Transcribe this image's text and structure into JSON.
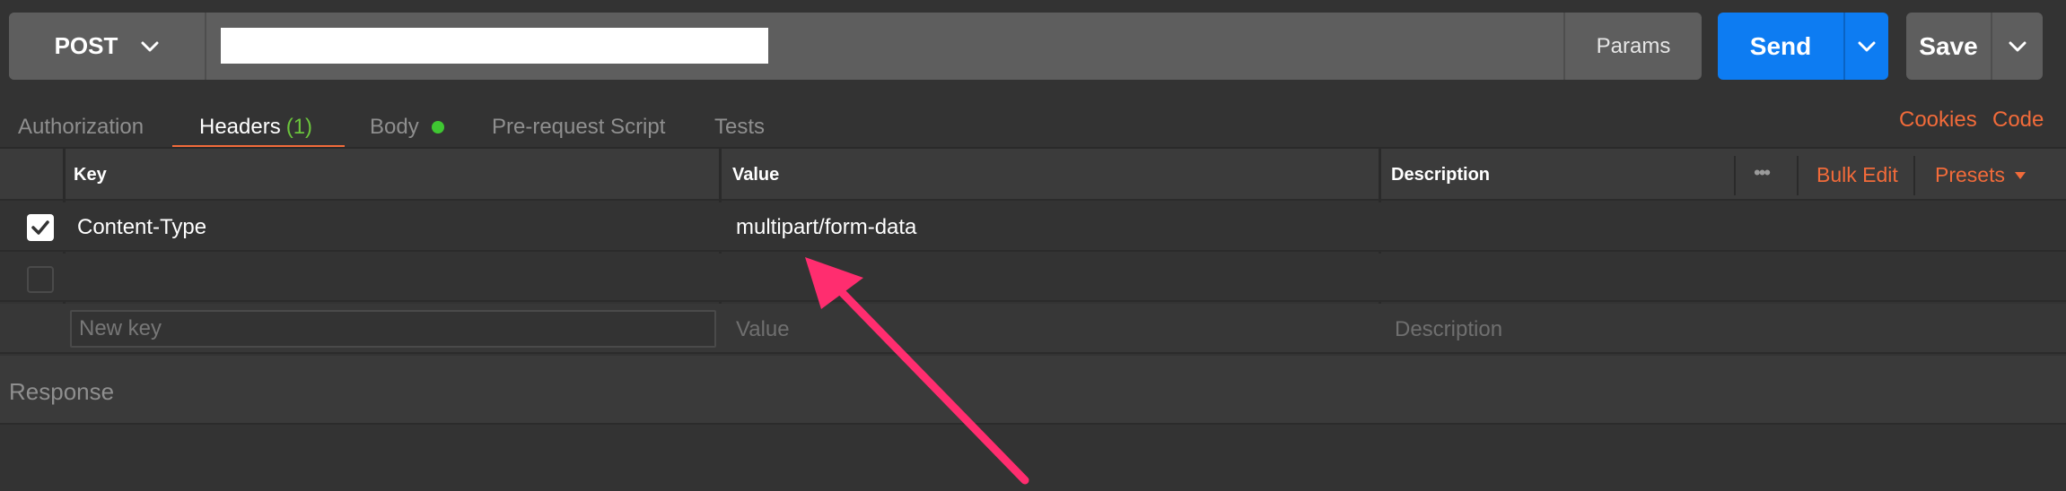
{
  "request": {
    "method": "POST",
    "url_value": "",
    "params_label": "Params",
    "send_label": "Send",
    "save_label": "Save"
  },
  "tabs": [
    {
      "label": "Authorization"
    },
    {
      "label": "Headers",
      "count": "(1)"
    },
    {
      "label": "Body"
    },
    {
      "label": "Pre-request Script"
    },
    {
      "label": "Tests"
    }
  ],
  "links": {
    "cookies": "Cookies",
    "code": "Code"
  },
  "headers_table": {
    "columns": {
      "key": "Key",
      "value": "Value",
      "description": "Description"
    },
    "more_label": "•••",
    "bulk_edit": "Bulk Edit",
    "presets": "Presets",
    "rows": [
      {
        "key": "Content-Type",
        "value": "multipart/form-data",
        "description": "",
        "checked": true
      },
      {
        "key": "",
        "value": "",
        "description": "",
        "checked": false
      }
    ],
    "new_row": {
      "key_placeholder": "New key",
      "value_placeholder": "Value",
      "description_placeholder": "Description"
    }
  },
  "response": {
    "label": "Response"
  },
  "colors": {
    "accent": "#f26b3a",
    "send": "#0d7cf2",
    "arrow": "#ff2d6f",
    "active_dot": "#3fc732"
  },
  "icons": {
    "method_chevron": "chevron-down-icon",
    "checkbox": "checkmark-icon",
    "presets_caret": "caret-down-icon",
    "annotation": "arrow-annotation"
  }
}
